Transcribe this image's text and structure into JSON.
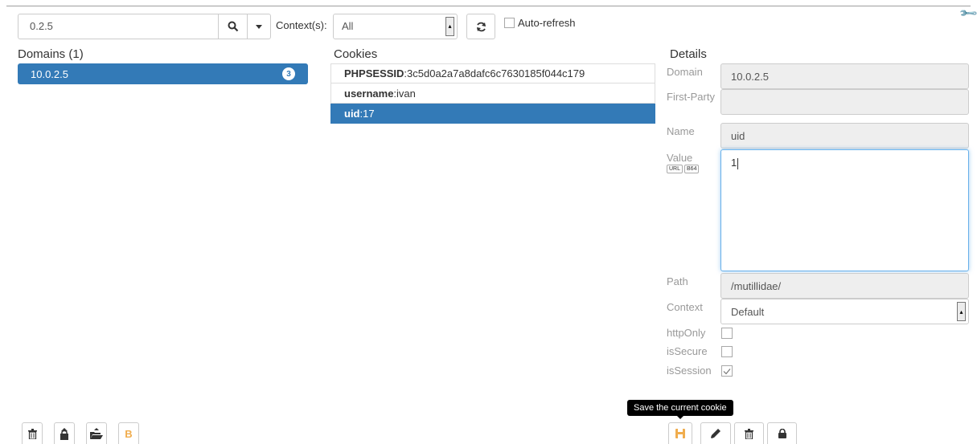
{
  "search": {
    "value": "0.2.5"
  },
  "context": {
    "label": "Context(s):",
    "selected": "All"
  },
  "auto_refresh": {
    "label": "Auto-refresh",
    "checked": false
  },
  "domains": {
    "title": "Domains (1)",
    "items": [
      {
        "name": "10.0.2.5",
        "count": "3"
      }
    ]
  },
  "cookies": {
    "title": "Cookies",
    "items": [
      {
        "name": "PHPSESSID",
        "value": ":3c5d0a2a7a8dafc6c7630185f044c179",
        "active": false
      },
      {
        "name": "username",
        "value": ":ivan",
        "active": false
      },
      {
        "name": "uid",
        "value": ":17",
        "active": true
      }
    ]
  },
  "details": {
    "title": "Details",
    "domain_label": "Domain",
    "domain_value": "10.0.2.5",
    "first_party_label": "First-Party",
    "first_party_value": "",
    "name_label": "Name",
    "name_value": "uid",
    "value_label": "Value",
    "value_value": "1",
    "url_tag": "URL",
    "b64_tag": "B64",
    "path_label": "Path",
    "path_value": "/mutillidae/",
    "context_label": "Context",
    "context_value": "Default",
    "httponly_label": "httpOnly",
    "httponly_checked": false,
    "issecure_label": "isSecure",
    "issecure_checked": false,
    "issession_label": "isSession",
    "issession_checked": true
  },
  "tooltip": "Save the current cookie",
  "bottom_left_tools": [
    "trash-icon",
    "lock-upload-icon",
    "folder-open-icon",
    "bitcoin-icon"
  ],
  "bottom_right_tools": [
    "save-icon",
    "pencil-icon",
    "trash-icon",
    "lock-icon"
  ],
  "colors": {
    "accent": "#337ab7",
    "orange": "#f0ad4e"
  }
}
